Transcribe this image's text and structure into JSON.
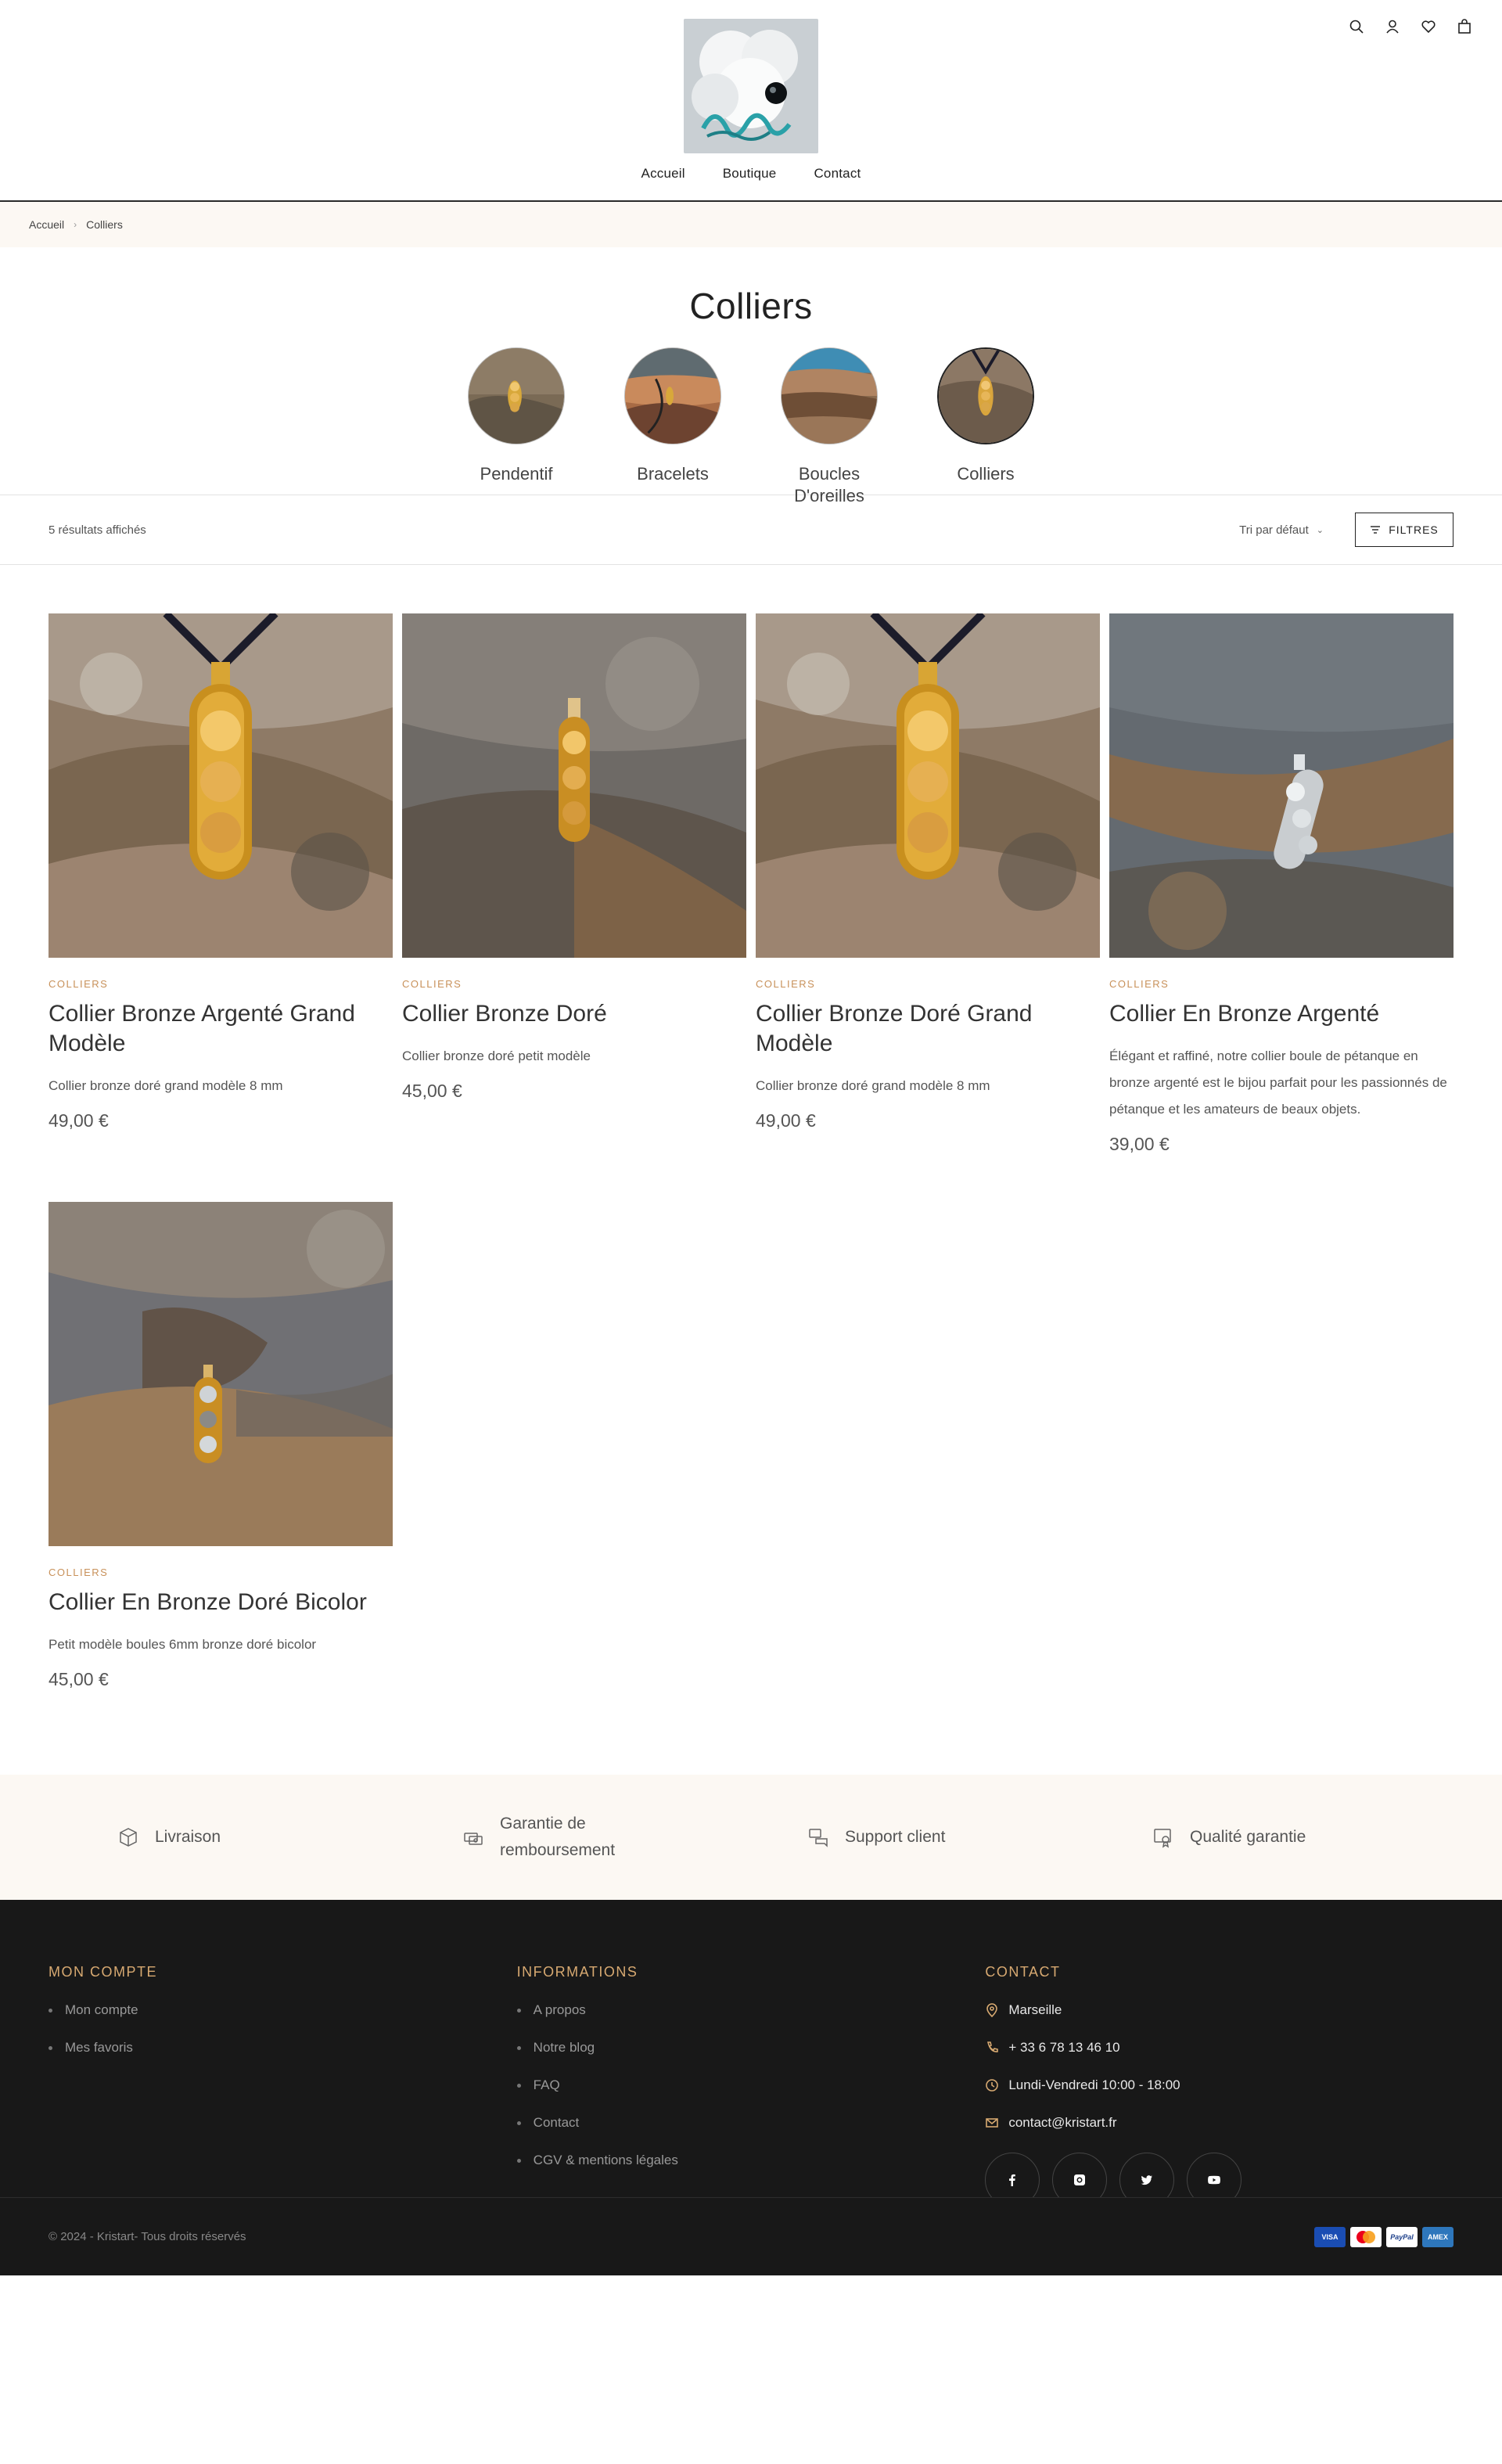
{
  "header": {
    "logo_alt": "Kristart",
    "nav": [
      "Accueil",
      "Boutique",
      "Contact"
    ],
    "icons": [
      "search-icon",
      "user-icon",
      "heart-icon",
      "bag-icon"
    ]
  },
  "breadcrumb": {
    "home": "Accueil",
    "current": "Colliers"
  },
  "page": {
    "title": "Colliers"
  },
  "categories": [
    {
      "label": "Pendentif"
    },
    {
      "label": "Bracelets"
    },
    {
      "label": "Boucles D'oreilles"
    },
    {
      "label": "Colliers"
    }
  ],
  "toolbar": {
    "results": "5 résultats affichés",
    "sort": "Tri par défaut",
    "filters": "FILTRES"
  },
  "products": [
    {
      "category": "COLLIERS",
      "name": "Collier Bronze Argenté Grand Modèle",
      "desc": "Collier bronze doré grand modèle 8 mm",
      "price": "49,00 €"
    },
    {
      "category": "COLLIERS",
      "name": "Collier Bronze Doré",
      "desc": "Collier bronze doré petit modèle",
      "price": "45,00 €"
    },
    {
      "category": "COLLIERS",
      "name": "Collier Bronze Doré Grand Modèle",
      "desc": "Collier bronze doré grand modèle 8 mm",
      "price": "49,00 €"
    },
    {
      "category": "COLLIERS",
      "name": "Collier En Bronze Argenté",
      "desc": "Élégant et raffiné, notre collier boule de pétanque en bronze argenté est le bijou parfait pour les passionnés de pétanque et les amateurs de beaux objets.",
      "price": "39,00 €"
    },
    {
      "category": "COLLIERS",
      "name": "Collier En Bronze Doré Bicolor",
      "desc": "Petit modèle boules 6mm bronze doré bicolor",
      "price": "45,00 €"
    }
  ],
  "features": [
    "Livraison",
    "Garantie de remboursement",
    "Support client",
    "Qualité garantie"
  ],
  "footer": {
    "account": {
      "title": "MON COMPTE",
      "items": [
        "Mon compte",
        "Mes favoris"
      ]
    },
    "info": {
      "title": "INFORMATIONS",
      "items": [
        "A propos",
        "Notre blog",
        "FAQ",
        "Contact",
        "CGV & mentions légales"
      ]
    },
    "contact": {
      "title": "CONTACT",
      "city": "Marseille",
      "phone": "+ 33 6 78 13 46 10",
      "hours": "Lundi-Vendredi 10:00 - 18:00",
      "email": "contact@kristart.fr"
    },
    "socials": [
      "facebook-icon",
      "instagram-icon",
      "twitter-icon",
      "youtube-icon"
    ],
    "copyright": "© 2024 - Kristart- Tous droits réservés",
    "payments": [
      "VISA",
      "MasterCard",
      "PayPal",
      "AMEX"
    ]
  },
  "colors": {
    "accent": "#c8915a",
    "footer_bg": "#181818",
    "cream": "#fcf8f3"
  }
}
